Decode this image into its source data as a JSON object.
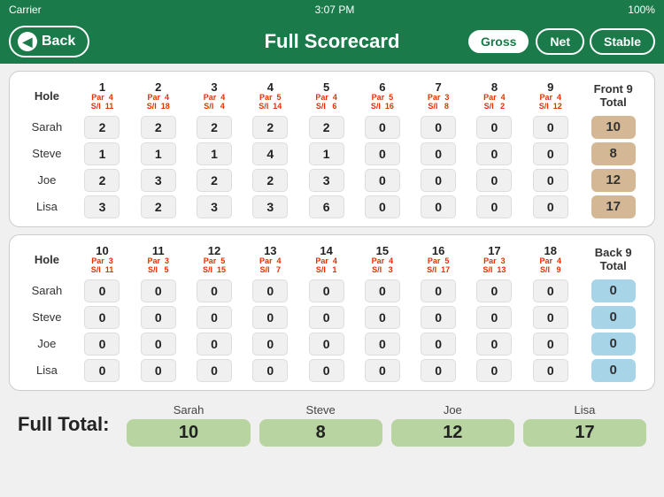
{
  "statusBar": {
    "carrier": "Carrier",
    "time": "3:07 PM",
    "signal": "✦",
    "battery": "100%"
  },
  "header": {
    "backLabel": "Back",
    "title": "Full Scorecard",
    "buttons": [
      {
        "label": "Gross",
        "active": true
      },
      {
        "label": "Net",
        "active": false
      },
      {
        "label": "Stable",
        "active": false
      }
    ]
  },
  "front9": {
    "sectionLabel": "Hole",
    "totalLabel": "Front 9\nTotal",
    "holes": [
      {
        "num": "1",
        "par": "Par",
        "parVal": "4",
        "si": "S/I",
        "siVal": "11"
      },
      {
        "num": "2",
        "par": "Par",
        "parVal": "4",
        "si": "S/I",
        "siVal": "18"
      },
      {
        "num": "3",
        "par": "Par",
        "parVal": "4",
        "si": "S/I",
        "siVal": "4"
      },
      {
        "num": "4",
        "par": "Par",
        "parVal": "5",
        "si": "S/I",
        "siVal": "14"
      },
      {
        "num": "5",
        "par": "Par",
        "parVal": "4",
        "si": "S/I",
        "siVal": "6"
      },
      {
        "num": "6",
        "par": "Par",
        "parVal": "5",
        "si": "S/I",
        "siVal": "16"
      },
      {
        "num": "7",
        "par": "Par",
        "parVal": "3",
        "si": "S/I",
        "siVal": "8"
      },
      {
        "num": "8",
        "par": "Par",
        "parVal": "4",
        "si": "S/I",
        "siVal": "2"
      },
      {
        "num": "9",
        "par": "Par",
        "parVal": "4",
        "si": "S/I",
        "siVal": "12"
      }
    ],
    "players": [
      {
        "name": "Sarah",
        "scores": [
          2,
          2,
          2,
          2,
          2,
          0,
          0,
          0,
          0
        ],
        "total": 10
      },
      {
        "name": "Steve",
        "scores": [
          1,
          1,
          1,
          4,
          1,
          0,
          0,
          0,
          0
        ],
        "total": 8
      },
      {
        "name": "Joe",
        "scores": [
          2,
          3,
          2,
          2,
          3,
          0,
          0,
          0,
          0
        ],
        "total": 12
      },
      {
        "name": "Lisa",
        "scores": [
          3,
          2,
          3,
          3,
          6,
          0,
          0,
          0,
          0
        ],
        "total": 17
      }
    ]
  },
  "back9": {
    "sectionLabel": "Hole",
    "totalLabel": "Back 9\nTotal",
    "holes": [
      {
        "num": "10",
        "par": "Par",
        "parVal": "3",
        "si": "S/I",
        "siVal": "11"
      },
      {
        "num": "11",
        "par": "Par",
        "parVal": "3",
        "si": "S/I",
        "siVal": "5"
      },
      {
        "num": "12",
        "par": "Par",
        "parVal": "5",
        "si": "S/I",
        "siVal": "15"
      },
      {
        "num": "13",
        "par": "Par",
        "parVal": "4",
        "si": "S/I",
        "siVal": "7"
      },
      {
        "num": "14",
        "par": "Par",
        "parVal": "4",
        "si": "S/I",
        "siVal": "1"
      },
      {
        "num": "15",
        "par": "Par",
        "parVal": "4",
        "si": "S/I",
        "siVal": "3"
      },
      {
        "num": "16",
        "par": "Par",
        "parVal": "5",
        "si": "S/I",
        "siVal": "17"
      },
      {
        "num": "17",
        "par": "Par",
        "parVal": "3",
        "si": "S/I",
        "siVal": "13"
      },
      {
        "num": "18",
        "par": "Par",
        "parVal": "4",
        "si": "S/I",
        "siVal": "9"
      }
    ],
    "players": [
      {
        "name": "Sarah",
        "scores": [
          0,
          0,
          0,
          0,
          0,
          0,
          0,
          0,
          0
        ],
        "total": 0
      },
      {
        "name": "Steve",
        "scores": [
          0,
          0,
          0,
          0,
          0,
          0,
          0,
          0,
          0
        ],
        "total": 0
      },
      {
        "name": "Joe",
        "scores": [
          0,
          0,
          0,
          0,
          0,
          0,
          0,
          0,
          0
        ],
        "total": 0
      },
      {
        "name": "Lisa",
        "scores": [
          0,
          0,
          0,
          0,
          0,
          0,
          0,
          0,
          0
        ],
        "total": 0
      }
    ]
  },
  "fullTotal": {
    "label": "Full Total:",
    "players": [
      {
        "name": "Sarah",
        "total": "10"
      },
      {
        "name": "Steve",
        "total": "8"
      },
      {
        "name": "Joe",
        "total": "12"
      },
      {
        "name": "Lisa",
        "total": "17"
      }
    ]
  }
}
